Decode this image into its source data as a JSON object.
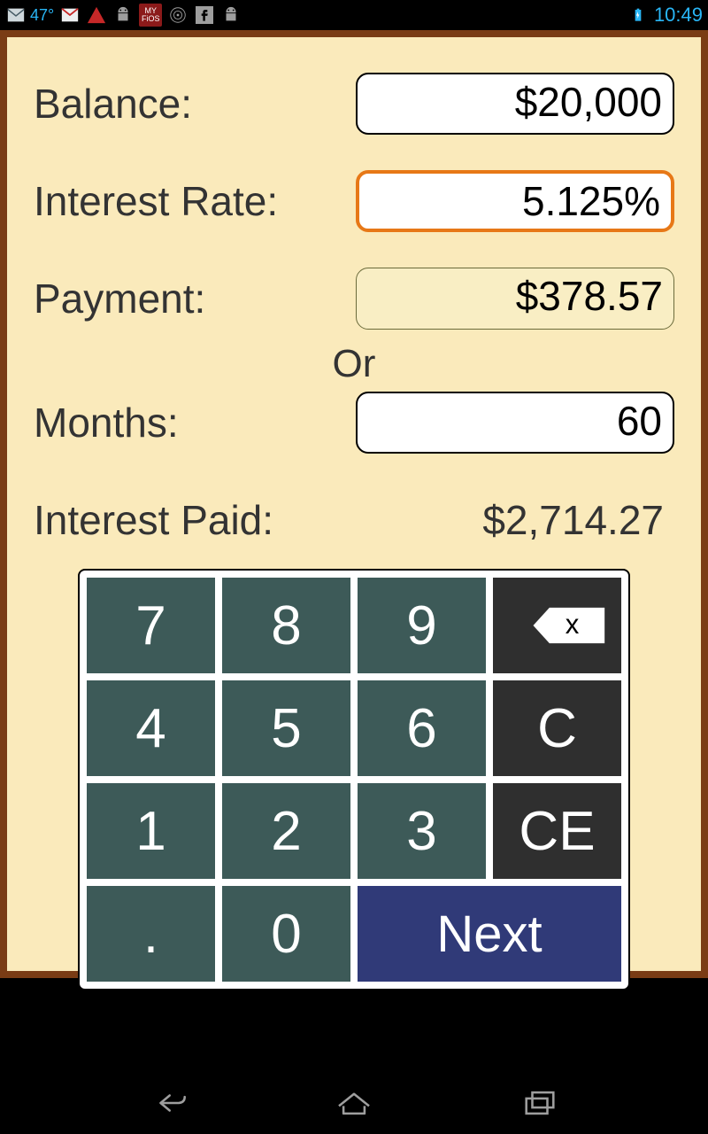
{
  "statusbar": {
    "temp": "47°",
    "clock": "10:49",
    "fios": "MY FiOS"
  },
  "form": {
    "balance_label": "Balance:",
    "balance_value": "$20,000",
    "rate_label": "Interest Rate:",
    "rate_value": "5.125%",
    "payment_label": "Payment:",
    "payment_value": "$378.57",
    "or_label": "Or",
    "months_label": "Months:",
    "months_value": "60",
    "interest_paid_label": "Interest Paid:",
    "interest_paid_value": "$2,714.27"
  },
  "keypad": {
    "k7": "7",
    "k8": "8",
    "k9": "9",
    "back": "x",
    "k4": "4",
    "k5": "5",
    "k6": "6",
    "c": "C",
    "k1": "1",
    "k2": "2",
    "k3": "3",
    "ce": "CE",
    "dot": ".",
    "k0": "0",
    "next": "Next"
  }
}
